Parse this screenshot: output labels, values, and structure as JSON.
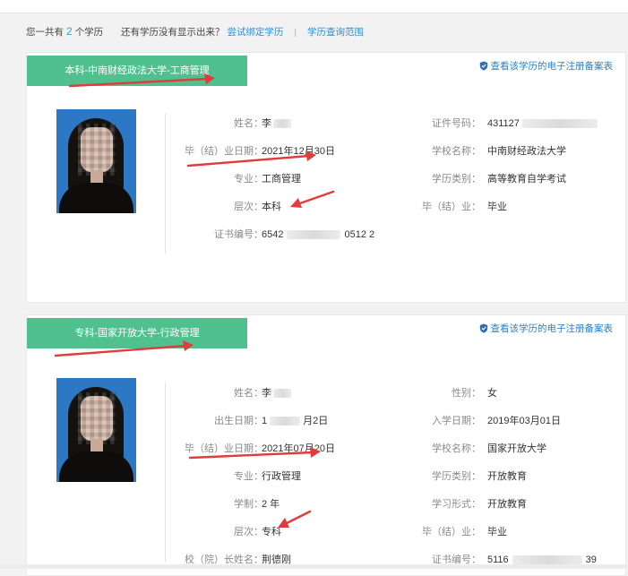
{
  "summary": {
    "prefix": "您一共有",
    "count": "2",
    "suffix": "个学历",
    "question": "还有学历没有显示出来？",
    "bind_link": "尝试绑定学历",
    "separator": "|",
    "scope_link": "学历查询范围"
  },
  "records": [
    {
      "tab": "本科-中南财经政法大学-工商管理",
      "report_link": "查看该学历的电子注册备案表",
      "fields": [
        {
          "label": "姓名：",
          "value": "李",
          "redacted": true
        },
        {
          "label": "证件号码：",
          "value": "431127",
          "redacted": true
        },
        {
          "label": "毕（结）业日期：",
          "value": "2021年12月30日"
        },
        {
          "label": "学校名称：",
          "value": "中南财经政法大学"
        },
        {
          "label": "专业：",
          "value": "工商管理"
        },
        {
          "label": "学历类别：",
          "value": "高等教育自学考试"
        },
        {
          "label": "层次：",
          "value": "本科"
        },
        {
          "label": "毕（结）业：",
          "value": "毕业"
        },
        {
          "label": "证书编号：",
          "value": "6542",
          "value_tail": "0512 2",
          "redacted": true
        }
      ]
    },
    {
      "tab": "专科-国家开放大学-行政管理",
      "report_link": "查看该学历的电子注册备案表",
      "fields": [
        {
          "label": "姓名：",
          "value": "李",
          "redacted": true
        },
        {
          "label": "性别：",
          "value": "女"
        },
        {
          "label": "出生日期：",
          "value": "1",
          "value_tail": "月2日",
          "redacted": true
        },
        {
          "label": "入学日期：",
          "value": "2019年03月01日"
        },
        {
          "label": "毕（结）业日期：",
          "value": "2021年07月20日"
        },
        {
          "label": "学校名称：",
          "value": "国家开放大学"
        },
        {
          "label": "专业：",
          "value": "行政管理"
        },
        {
          "label": "学历类别：",
          "value": "开放教育"
        },
        {
          "label": "学制：",
          "value": "2 年"
        },
        {
          "label": "学习形式：",
          "value": "开放教育"
        },
        {
          "label": "层次：",
          "value": "专科"
        },
        {
          "label": "毕（结）业：",
          "value": "毕业"
        },
        {
          "label": "校（院）长姓名：",
          "value": "荆德刚"
        },
        {
          "label": "证书编号：",
          "value": "5116",
          "value_tail": "39",
          "redacted": true
        }
      ]
    }
  ],
  "icons": {
    "report": "shield-icon"
  },
  "colors": {
    "tab_green": "#51c08f",
    "link_blue": "#2f8fd0",
    "annotation_arrow": "#e23b3b",
    "photo_background": "#2d78c4"
  }
}
